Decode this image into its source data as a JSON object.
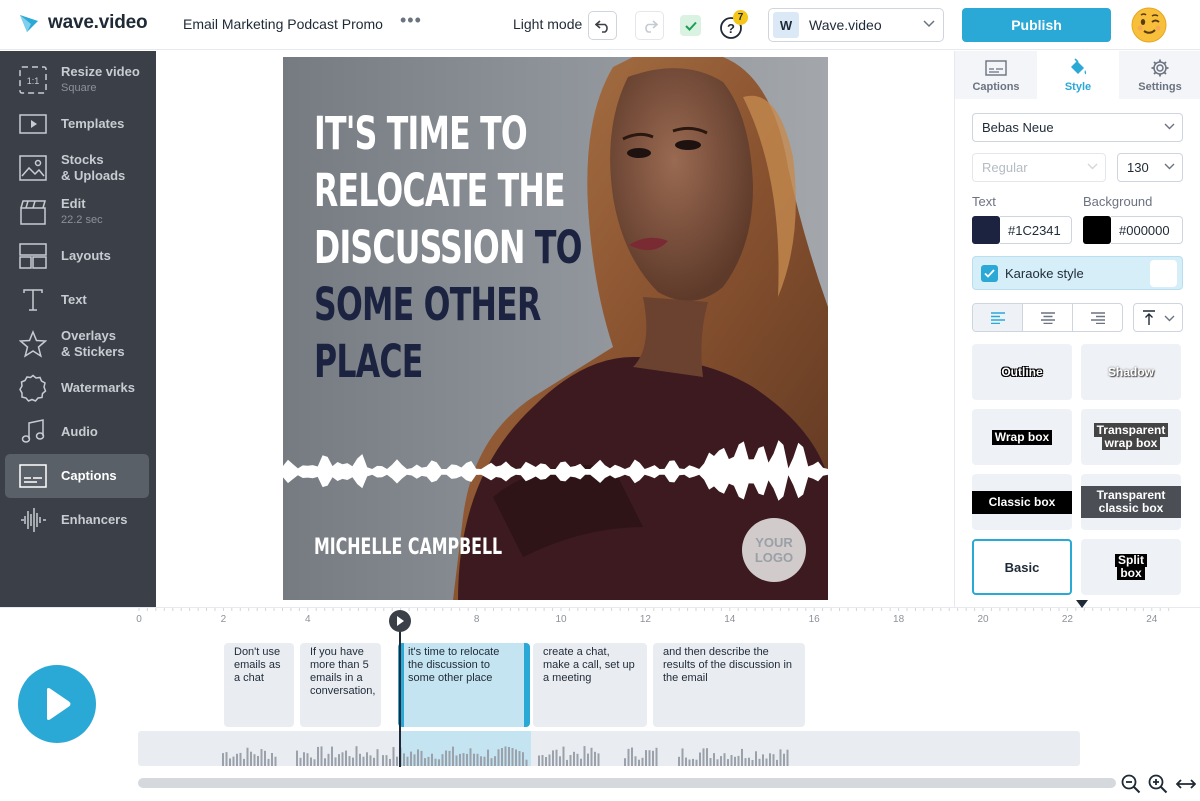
{
  "app": {
    "name": "wave.video"
  },
  "header": {
    "project_title": "Email Marketing Podcast Promo",
    "more_label": "•••",
    "light_mode_label": "Light mode",
    "help_badge": "7",
    "workspace": {
      "initial": "W",
      "name": "Wave.video"
    },
    "publish_label": "Publish"
  },
  "sidebar": {
    "items": [
      {
        "label": "Resize video",
        "sub": "Square",
        "icon": "resize-icon"
      },
      {
        "label": "Templates",
        "sub": "",
        "icon": "templates-icon"
      },
      {
        "label": "Stocks",
        "label2": "& Uploads",
        "icon": "stocks-icon"
      },
      {
        "label": "Edit",
        "sub": "22.2 sec",
        "icon": "clapperboard-icon"
      },
      {
        "label": "Layouts",
        "sub": "",
        "icon": "layouts-icon"
      },
      {
        "label": "Text",
        "sub": "",
        "icon": "text-icon"
      },
      {
        "label": "Overlays",
        "label2": "& Stickers",
        "icon": "star-icon"
      },
      {
        "label": "Watermarks",
        "sub": "",
        "icon": "watermark-icon"
      },
      {
        "label": "Audio",
        "sub": "",
        "icon": "music-icon"
      },
      {
        "label": "Captions",
        "sub": "",
        "icon": "captions-icon"
      },
      {
        "label": "Enhancers",
        "sub": "",
        "icon": "soundwave-icon"
      }
    ],
    "resize_icon_text": "1:1"
  },
  "canvas": {
    "headline_white": [
      "IT'S TIME TO",
      "RELOCATE THE",
      "DISCUSSION"
    ],
    "headline_dark_inline": "TO",
    "headline_dark": [
      "SOME OTHER",
      "PLACE"
    ],
    "speaker_name": "MICHELLE CAMPBELL",
    "logo_placeholder_1": "YOUR",
    "logo_placeholder_2": "LOGO"
  },
  "right_panel": {
    "tabs": [
      {
        "label": "Captions"
      },
      {
        "label": "Style"
      },
      {
        "label": "Settings"
      }
    ],
    "font_family": "Bebas Neue",
    "font_weight": "Regular",
    "font_size": "130",
    "text_label": "Text",
    "text_color": "#1C2341",
    "background_label": "Background",
    "background_color": "#000000",
    "karaoke_label": "Karaoke style",
    "presets": {
      "outline": "Outline",
      "shadow": "Shadow",
      "wrap_box": "Wrap box",
      "transparent_wrap_1": "Transparent",
      "transparent_wrap_2": "wrap box",
      "classic_box": "Classic box",
      "transparent_classic_1": "Transparent",
      "transparent_classic_2": "classic box",
      "basic": "Basic",
      "split_1": "Split",
      "split_2": "box"
    }
  },
  "timeline": {
    "ticks": [
      "0",
      "2",
      "4",
      "6",
      "8",
      "10",
      "12",
      "14",
      "16",
      "18",
      "20",
      "22",
      "24"
    ],
    "clips": [
      {
        "text": "Don't use emails as a chat"
      },
      {
        "text": "If you have more than 5 emails in a conversation,"
      },
      {
        "text": "it's time to relocate the discussion to some other place"
      },
      {
        "text": "create a chat, make a call, set up a meeting"
      },
      {
        "text": "and then describe the results of the discussion in the email"
      }
    ]
  },
  "colors": {
    "accent": "#2aa8d6",
    "sidebar": "#3b4048",
    "caption_text": "#1c2341"
  }
}
